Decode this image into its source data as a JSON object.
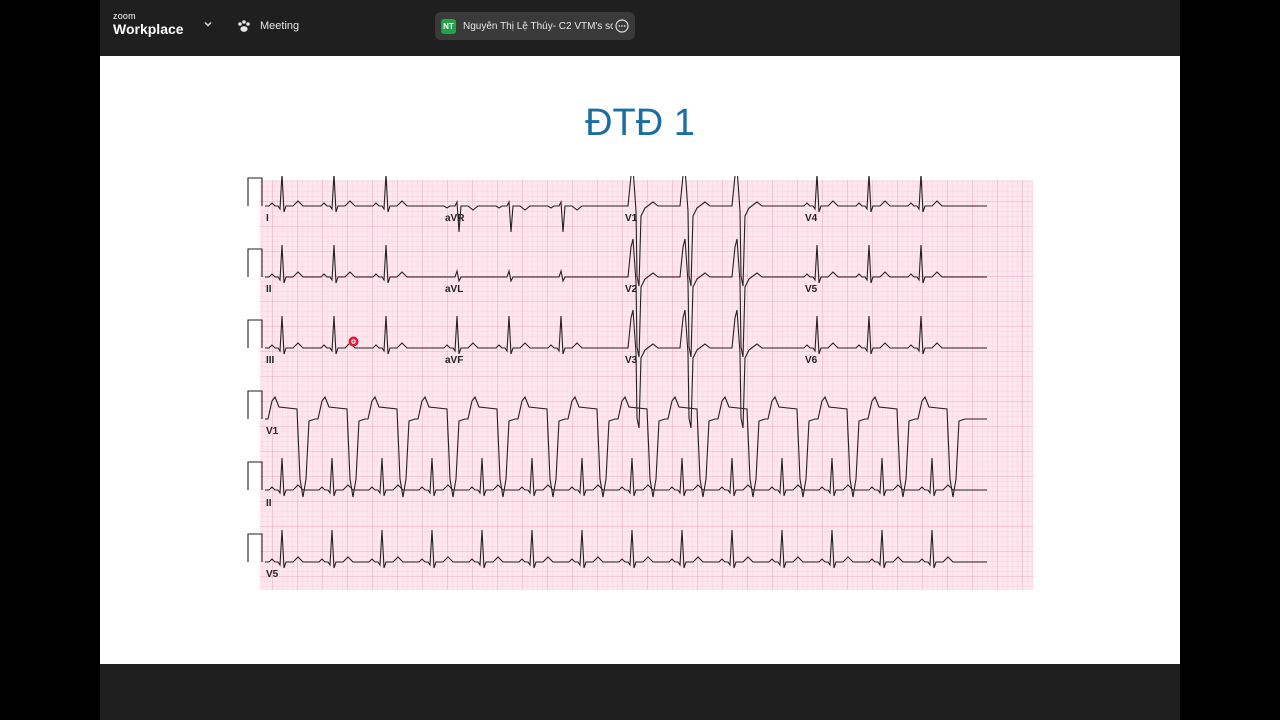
{
  "app": {
    "brand_small": "zoom",
    "brand_name": "Workplace",
    "brand_chevron_icon": "chevron-down-icon",
    "meeting_icon": "paw-icon",
    "meeting_label": "Meeting",
    "share": {
      "initials": "NT",
      "label": "Nguyễn Thị Lệ Thúy- C2 VTM's sc",
      "more_icon": "more-options-icon"
    }
  },
  "slide": {
    "title": "ĐTĐ 1",
    "ecg": {
      "grid_minor_color": "#f7c3d4",
      "grid_major_color": "#eb9ab5",
      "paper_color": "#fde6ee",
      "trace_color": "#222222",
      "lead_labels": [
        "I",
        "aVR",
        "V1",
        "V4",
        "II",
        "aVL",
        "V2",
        "V5",
        "III",
        "aVF",
        "V3",
        "V6",
        "V1",
        "II",
        "V5"
      ]
    }
  },
  "pointer_icon": "laser-pointer-icon"
}
